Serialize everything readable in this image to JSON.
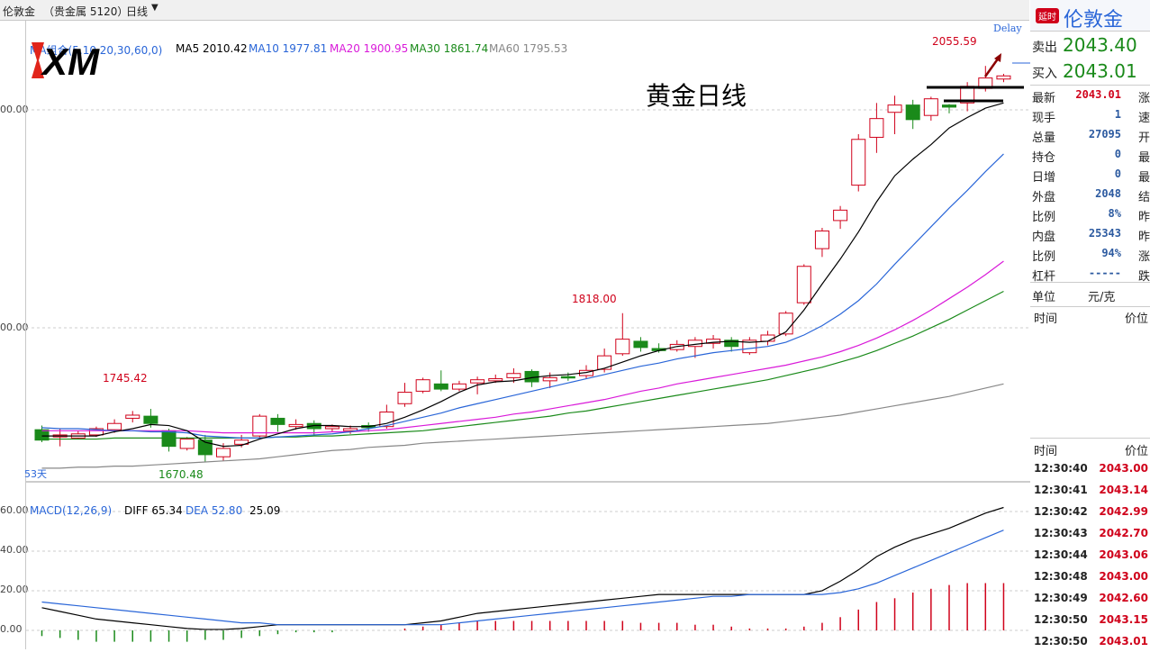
{
  "topbar": {
    "symbol": "伦敦金",
    "market": "（贵金属 5120）",
    "period": "日线"
  },
  "ma_legend": {
    "group": "MA组合(5,10,20,30,60,0)",
    "ma5": "MA5 2010.42",
    "ma10": "MA10 1977.81",
    "ma20": "MA20 1900.95",
    "ma30": "MA30 1861.74",
    "ma60": "MA60 1795.53",
    "delay": "Delay",
    "colors": {
      "ma5": "#000000",
      "ma10": "#2a66d8",
      "ma20": "#d91ad9",
      "ma30": "#1a8a1a",
      "ma60": "#888888"
    }
  },
  "logo": "XM",
  "overlay_title": "黄金日线",
  "annotations": {
    "high": "2055.59",
    "mid_high": "1818.00",
    "left_high": "1745.42",
    "low": "1670.48",
    "days": "53天"
  },
  "yaxis_main": [
    "00.00",
    "00.00"
  ],
  "macd_legend": {
    "name": "MACD(12,26,9)",
    "diff": "DIFF 65.34",
    "dea": "DEA 52.80",
    "macd": "25.09"
  },
  "yaxis_macd": [
    "60.00",
    "40.00",
    "20.00",
    "0.00"
  ],
  "chart_data": {
    "type": "candlestick",
    "candles": [
      {
        "o": 1706,
        "c": 1696,
        "h": 1710,
        "l": 1694
      },
      {
        "o": 1699,
        "c": 1701,
        "h": 1707,
        "l": 1690
      },
      {
        "o": 1698,
        "c": 1702,
        "h": 1705,
        "l": 1697
      },
      {
        "o": 1701,
        "c": 1707,
        "h": 1709,
        "l": 1699
      },
      {
        "o": 1706,
        "c": 1712,
        "h": 1716,
        "l": 1703
      },
      {
        "o": 1717,
        "c": 1720,
        "h": 1724,
        "l": 1713
      },
      {
        "o": 1719,
        "c": 1712,
        "h": 1726,
        "l": 1708
      },
      {
        "o": 1705,
        "c": 1690,
        "h": 1707,
        "l": 1685
      },
      {
        "o": 1688,
        "c": 1697,
        "h": 1699,
        "l": 1686
      },
      {
        "o": 1696,
        "c": 1682,
        "h": 1701,
        "l": 1675
      },
      {
        "o": 1680,
        "c": 1688,
        "h": 1693,
        "l": 1676
      },
      {
        "o": 1692,
        "c": 1696,
        "h": 1701,
        "l": 1689
      },
      {
        "o": 1700,
        "c": 1719,
        "h": 1721,
        "l": 1697
      },
      {
        "o": 1717,
        "c": 1711,
        "h": 1721,
        "l": 1704
      },
      {
        "o": 1709,
        "c": 1711,
        "h": 1716,
        "l": 1706
      },
      {
        "o": 1712,
        "c": 1707,
        "h": 1715,
        "l": 1700
      },
      {
        "o": 1707,
        "c": 1709,
        "h": 1711,
        "l": 1704
      },
      {
        "o": 1705,
        "c": 1707,
        "h": 1710,
        "l": 1702
      },
      {
        "o": 1710,
        "c": 1708,
        "h": 1713,
        "l": 1704
      },
      {
        "o": 1709,
        "c": 1723,
        "h": 1730,
        "l": 1707
      },
      {
        "o": 1731,
        "c": 1742,
        "h": 1751,
        "l": 1728
      },
      {
        "o": 1743,
        "c": 1754,
        "h": 1756,
        "l": 1741
      },
      {
        "o": 1750,
        "c": 1745,
        "h": 1763,
        "l": 1743
      },
      {
        "o": 1745,
        "c": 1750,
        "h": 1753,
        "l": 1743
      },
      {
        "o": 1751,
        "c": 1754,
        "h": 1757,
        "l": 1740
      },
      {
        "o": 1753,
        "c": 1755,
        "h": 1759,
        "l": 1751
      },
      {
        "o": 1756,
        "c": 1760,
        "h": 1765,
        "l": 1751
      },
      {
        "o": 1762,
        "c": 1752,
        "h": 1764,
        "l": 1747
      },
      {
        "o": 1753,
        "c": 1756,
        "h": 1761,
        "l": 1746
      },
      {
        "o": 1757,
        "c": 1756,
        "h": 1761,
        "l": 1753
      },
      {
        "o": 1758,
        "c": 1763,
        "h": 1768,
        "l": 1755
      },
      {
        "o": 1764,
        "c": 1777,
        "h": 1784,
        "l": 1761
      },
      {
        "o": 1779,
        "c": 1793,
        "h": 1818,
        "l": 1777
      },
      {
        "o": 1791,
        "c": 1785,
        "h": 1795,
        "l": 1781
      },
      {
        "o": 1784,
        "c": 1782,
        "h": 1789,
        "l": 1780
      },
      {
        "o": 1783,
        "c": 1788,
        "h": 1792,
        "l": 1781
      },
      {
        "o": 1786,
        "c": 1792,
        "h": 1795,
        "l": 1775
      },
      {
        "o": 1789,
        "c": 1793,
        "h": 1797,
        "l": 1784
      },
      {
        "o": 1792,
        "c": 1786,
        "h": 1795,
        "l": 1781
      },
      {
        "o": 1780,
        "c": 1792,
        "h": 1795,
        "l": 1778
      },
      {
        "o": 1791,
        "c": 1797,
        "h": 1801,
        "l": 1787
      },
      {
        "o": 1798,
        "c": 1818,
        "h": 1820,
        "l": 1796
      },
      {
        "o": 1828,
        "c": 1863,
        "h": 1865,
        "l": 1826
      },
      {
        "o": 1880,
        "c": 1897,
        "h": 1900,
        "l": 1872
      },
      {
        "o": 1907,
        "c": 1917,
        "h": 1921,
        "l": 1899
      },
      {
        "o": 1941,
        "c": 1985,
        "h": 1990,
        "l": 1935
      },
      {
        "o": 1987,
        "c": 2005,
        "h": 2020,
        "l": 1972
      },
      {
        "o": 2011,
        "c": 2018,
        "h": 2027,
        "l": 1990
      },
      {
        "o": 2018,
        "c": 2004,
        "h": 2023,
        "l": 1995
      },
      {
        "o": 2008,
        "c": 2024,
        "h": 2026,
        "l": 2003
      },
      {
        "o": 2018,
        "c": 2016,
        "h": 2019,
        "l": 2010
      },
      {
        "o": 2020,
        "c": 2036,
        "h": 2040,
        "l": 2012
      },
      {
        "o": 2034,
        "c": 2044,
        "h": 2055.59,
        "l": 2031
      },
      {
        "o": 2043,
        "c": 2046,
        "h": 2048,
        "l": 2040
      }
    ],
    "ma5": [
      1700,
      1700,
      1700,
      1700,
      1704,
      1707,
      1711,
      1710,
      1705,
      1694,
      1690,
      1691,
      1697,
      1702,
      1707,
      1710,
      1710,
      1709,
      1709,
      1712,
      1718,
      1725,
      1733,
      1742,
      1749,
      1752,
      1753,
      1756,
      1758,
      1759,
      1761,
      1765,
      1771,
      1777,
      1782,
      1786,
      1788,
      1790,
      1791,
      1790,
      1791,
      1800,
      1821,
      1846,
      1870,
      1896,
      1925,
      1950,
      1966,
      1980,
      1996,
      2006,
      2015,
      2020
    ],
    "ma10": [
      1708,
      1707,
      1707,
      1706,
      1705,
      1705,
      1704,
      1704,
      1703,
      1700,
      1699,
      1698,
      1698,
      1699,
      1700,
      1701,
      1702,
      1704,
      1707,
      1710,
      1714,
      1718,
      1722,
      1727,
      1731,
      1735,
      1739,
      1743,
      1747,
      1751,
      1755,
      1759,
      1763,
      1767,
      1770,
      1774,
      1777,
      1780,
      1782,
      1784,
      1786,
      1790,
      1797,
      1806,
      1817,
      1830,
      1846,
      1865,
      1883,
      1901,
      1919,
      1936,
      1954,
      1971
    ],
    "ma20": [
      1705,
      1705,
      1705,
      1705,
      1705,
      1705,
      1705,
      1705,
      1705,
      1704,
      1703,
      1703,
      1703,
      1703,
      1703,
      1703,
      1704,
      1704,
      1705,
      1706,
      1708,
      1710,
      1712,
      1714,
      1716,
      1718,
      1721,
      1723,
      1726,
      1729,
      1732,
      1735,
      1739,
      1743,
      1746,
      1750,
      1753,
      1756,
      1759,
      1762,
      1765,
      1768,
      1772,
      1776,
      1781,
      1787,
      1794,
      1802,
      1811,
      1821,
      1832,
      1843,
      1855,
      1868
    ],
    "ma30": [
      1697,
      1697,
      1697,
      1697,
      1698,
      1698,
      1698,
      1698,
      1698,
      1698,
      1698,
      1698,
      1698,
      1699,
      1699,
      1700,
      1700,
      1701,
      1702,
      1703,
      1704,
      1705,
      1707,
      1709,
      1711,
      1713,
      1715,
      1717,
      1719,
      1722,
      1724,
      1727,
      1730,
      1733,
      1736,
      1739,
      1742,
      1745,
      1748,
      1751,
      1754,
      1758,
      1762,
      1766,
      1771,
      1776,
      1782,
      1789,
      1796,
      1804,
      1812,
      1821,
      1830,
      1839
    ],
    "ma60": [
      1669,
      1669,
      1670,
      1670,
      1671,
      1671,
      1672,
      1673,
      1674,
      1675,
      1676,
      1677,
      1678,
      1680,
      1682,
      1684,
      1686,
      1687,
      1689,
      1690,
      1691,
      1693,
      1694,
      1695,
      1696,
      1697,
      1698,
      1699,
      1700,
      1701,
      1702,
      1703,
      1704,
      1705,
      1706,
      1707,
      1708,
      1709,
      1710,
      1711,
      1712,
      1714,
      1716,
      1718,
      1720,
      1723,
      1726,
      1729,
      1732,
      1735,
      1738,
      1742,
      1746,
      1750
    ],
    "diff": [
      12,
      10,
      8,
      6,
      5,
      4,
      3,
      2,
      1,
      0.5,
      0.5,
      1,
      2,
      3,
      3,
      3,
      3,
      3,
      3,
      3,
      3,
      4,
      5,
      7,
      9,
      10,
      11,
      12,
      13,
      14,
      15,
      16,
      17,
      18,
      19,
      19,
      19,
      19,
      19,
      19,
      19,
      19,
      19,
      21,
      26,
      32,
      39,
      44,
      48,
      51,
      54,
      58,
      62,
      65
    ],
    "dea": [
      15,
      14,
      13,
      12,
      11,
      10,
      9,
      8,
      7,
      6,
      5,
      4,
      4,
      3,
      3,
      3,
      3,
      3,
      3,
      3,
      3,
      3,
      3,
      4,
      5,
      6,
      7,
      8,
      9,
      10,
      11,
      12,
      13,
      14,
      15,
      16,
      17,
      18,
      18,
      19,
      19,
      19,
      19,
      19,
      20,
      22,
      25,
      29,
      33,
      37,
      41,
      45,
      49,
      53
    ],
    "hist": [
      -3,
      -4,
      -5,
      -6,
      -6,
      -6,
      -6,
      -6,
      -6,
      -5,
      -5,
      -4,
      -3,
      -2,
      -1,
      -1,
      -1,
      0,
      0,
      0,
      1,
      2,
      3,
      4,
      5,
      5,
      5,
      5,
      5,
      5,
      5,
      5,
      5,
      4,
      4,
      4,
      3,
      3,
      2,
      1,
      1,
      1,
      2,
      4,
      7,
      11,
      15,
      17,
      20,
      22,
      24,
      25,
      25,
      25
    ],
    "main_range": [
      1662,
      2080
    ],
    "macd_range": [
      -10,
      70
    ]
  },
  "quote": {
    "brand_tag": "延时",
    "brand": "伦敦金",
    "sell_label": "卖出",
    "sell": "2043.40",
    "buy_label": "买入",
    "buy": "2043.01",
    "stats": [
      {
        "label": "最新",
        "value": "2043.01",
        "right": "涨"
      },
      {
        "label": "现手",
        "value": "1",
        "right": "速"
      },
      {
        "label": "总量",
        "value": "27095",
        "right": "开"
      },
      {
        "label": "持仓",
        "value": "0",
        "right": "最"
      },
      {
        "label": "日增",
        "value": "0",
        "right": "最"
      },
      {
        "label": "外盘",
        "value": "2048",
        "right": "结"
      },
      {
        "label": "比例",
        "value": "8%",
        "right": "昨"
      },
      {
        "label": "内盘",
        "value": "25343",
        "right": "昨"
      },
      {
        "label": "比例",
        "value": "94%",
        "right": "涨"
      },
      {
        "label": "杠杆",
        "value": "-----",
        "right": "跌"
      }
    ],
    "unit_label": "单位",
    "unit": "元/克",
    "time_header": "时间",
    "price_header": "价位",
    "ticks": [
      {
        "time": "12:30:40",
        "price": "2043.00"
      },
      {
        "time": "12:30:41",
        "price": "2043.14"
      },
      {
        "time": "12:30:42",
        "price": "2042.99"
      },
      {
        "time": "12:30:43",
        "price": "2042.70"
      },
      {
        "time": "12:30:44",
        "price": "2043.06"
      },
      {
        "time": "12:30:48",
        "price": "2043.00"
      },
      {
        "time": "12:30:49",
        "price": "2042.60"
      },
      {
        "time": "12:30:50",
        "price": "2043.15"
      },
      {
        "time": "12:30:50",
        "price": "2043.01"
      }
    ]
  }
}
